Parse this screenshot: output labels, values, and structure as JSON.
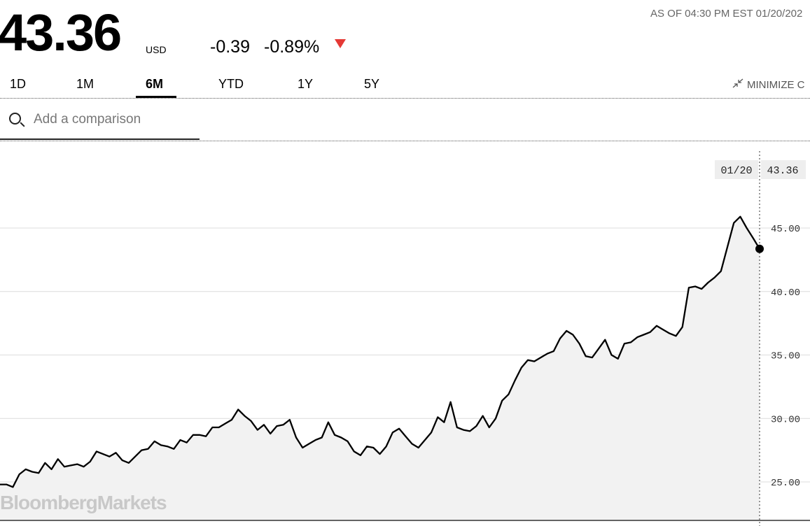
{
  "quote": {
    "price": "43.36",
    "currency": "USD",
    "change": "-0.39",
    "change_percent": "-0.89%",
    "as_of": "AS OF 04:30 PM EST 01/20/202",
    "down_color": "#e53935"
  },
  "ranges": {
    "tabs": [
      "1D",
      "1M",
      "6M",
      "YTD",
      "1Y",
      "5Y"
    ],
    "active": "6M",
    "minimize_label": "MINIMIZE C"
  },
  "search": {
    "placeholder": "Add a comparison"
  },
  "watermark": "BloombergMarkets",
  "chart_data": {
    "type": "line",
    "ylim": [
      22.0,
      47.5
    ],
    "yticks": [
      "25.00",
      "30.00",
      "35.00",
      "40.00",
      "45.00"
    ],
    "grid": true,
    "tooltip": {
      "date": "01/20",
      "value": "43.36"
    },
    "series": [
      {
        "values": [
          24.8,
          24.8,
          24.6,
          25.6,
          26.0,
          25.8,
          25.7,
          26.5,
          26.0,
          26.8,
          26.2,
          26.3,
          26.4,
          26.2,
          26.6,
          27.4,
          27.2,
          27.0,
          27.3,
          26.7,
          26.5,
          27.0,
          27.5,
          27.6,
          28.2,
          27.9,
          27.8,
          27.6,
          28.3,
          28.1,
          28.7,
          28.7,
          28.6,
          29.3,
          29.3,
          29.6,
          29.9,
          30.7,
          30.2,
          29.8,
          29.1,
          29.5,
          28.8,
          29.4,
          29.5,
          29.9,
          28.5,
          27.7,
          28.0,
          28.3,
          28.5,
          29.7,
          28.7,
          28.5,
          28.2,
          27.4,
          27.1,
          27.8,
          27.7,
          27.2,
          27.8,
          28.9,
          29.2,
          28.6,
          28.0,
          27.7,
          28.3,
          28.9,
          30.1,
          29.7,
          31.3,
          29.3,
          29.1,
          29.0,
          29.4,
          30.2,
          29.3,
          30.0,
          31.4,
          31.9,
          33.0,
          34.0,
          34.6,
          34.5,
          34.8,
          35.1,
          35.3,
          36.3,
          36.9,
          36.6,
          35.9,
          34.9,
          34.8,
          35.5,
          36.2,
          35.0,
          34.7,
          35.9,
          36.0,
          36.4,
          36.6,
          36.8,
          37.3,
          37.0,
          36.7,
          36.5,
          37.2,
          40.3,
          40.4,
          40.2,
          40.7,
          41.1,
          41.6,
          43.5,
          45.4,
          45.9,
          45.0,
          44.2,
          43.36
        ]
      }
    ]
  }
}
